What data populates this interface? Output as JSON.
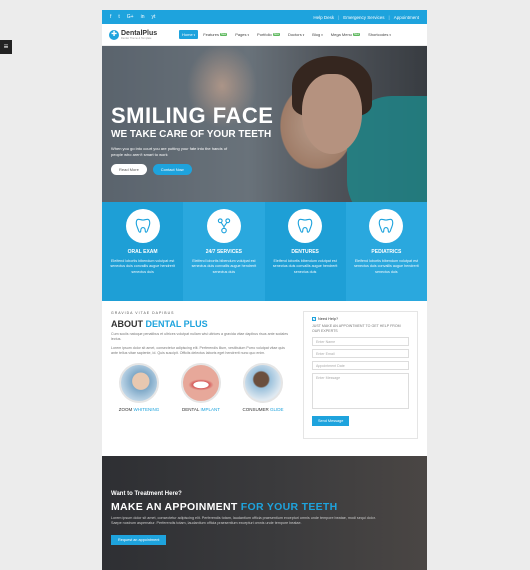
{
  "side_tab": "≡",
  "topbar": {
    "social": [
      "f",
      "t",
      "G+",
      "in",
      "yt"
    ],
    "links": [
      "Help Desk",
      "Emergency Services",
      "Appointment"
    ]
  },
  "header": {
    "logo_name": "DentalPlus",
    "logo_tagline": "Dentist Theme & Template",
    "nav": [
      {
        "label": "Home",
        "badge": "",
        "active": true
      },
      {
        "label": "Features",
        "badge": "New",
        "active": false
      },
      {
        "label": "Pages",
        "badge": "",
        "active": false
      },
      {
        "label": "Portfolio",
        "badge": "New",
        "active": false
      },
      {
        "label": "Doctors",
        "badge": "",
        "active": false
      },
      {
        "label": "Blog",
        "badge": "",
        "active": false
      },
      {
        "label": "Mega Menu",
        "badge": "New",
        "active": false
      },
      {
        "label": "Shortcodes",
        "badge": "",
        "active": false
      }
    ]
  },
  "hero": {
    "title": "SMILING FACE",
    "subtitle": "WE TAKE CARE OF YOUR TEETH",
    "desc": "When you go into court you are putting your fate into the hands of people who aren't smart to work",
    "read_more": "Read More",
    "contact_now": "Contact Now"
  },
  "services": [
    {
      "title": "ORAL EXAM",
      "text": "Eleifend lobortis bibendum volutpat est senectus duis convallis augue hendrerit senectus duis",
      "icon": "tooth-icon"
    },
    {
      "title": "24/7 SERVICES",
      "text": "Eleifend lobortis bibendum volutpat est senectus duis convallis augue hendrerit senectus duis",
      "icon": "dental-tool-icon"
    },
    {
      "title": "DENTURES",
      "text": "Eleifend lobortis bibendum volutpat est senectus duis convallis augue hendrerit senectus duis",
      "icon": "tooth-icon"
    },
    {
      "title": "PEDIATRICS",
      "text": "Eleifend lobortis bibendum volutpat est senectus duis convallis augue hendrerit senectus duis",
      "icon": "tooth-icon"
    }
  ],
  "about": {
    "eyebrow": "GRAVIDA VITAE DAPIBUS",
    "title_prefix": "ABOUT",
    "title_accent": "DENTAL PLUS",
    "p1": "Cum sociis natoque penatibus et ultrices volutpat nullam wisi ultrices a gravida vitae dapibus risus ante sodales lectus.",
    "p2": "Lorem ipsum dolor sit amet, consectetur adipiscing elit. Perferendis illum, vestibulum Porro volutpat vitae quis ante tellus vitae sapiente, id. Quis suscipit. Officiis delectus laboris eget hendrerit nunc quo enim.",
    "team": [
      {
        "label": "ZOOM",
        "accent": "WHITENING"
      },
      {
        "label": "DENTAL",
        "accent": "IMPLANT"
      },
      {
        "label": "CONSUMER",
        "accent": "GLIDE"
      }
    ]
  },
  "form": {
    "checkbox_label": "Need Help?",
    "note": "JUST MAKE AN APPOINTMENT TO GET HELP FROM OUR EXPERTS",
    "name_ph": "Enter Name",
    "email_ph": "Enter Email",
    "date_ph": "Appointment Date",
    "message_ph": "Enter Message",
    "send": "Send Message"
  },
  "cta": {
    "small": "Want to Treatment Here?",
    "title_prefix": "MAKE AN APPOINMENT",
    "title_accent": "FOR YOUR TEETH",
    "text": "Lorem ipsum dolor sit amet, consectetur adipiscing elit. Perferendis totam, laudantium officia praesentium excepturi omnis unde tempore beatae, modi sequi dolor. Saepe nostrum aspernatur. Perferendis totam, laudantium officia praesentium excepturi omnis unde tempore beatae.",
    "button": "Request an appointment"
  },
  "colors": {
    "accent": "#1ea3dd",
    "badge": "#5cb85c",
    "dark": "#333333"
  }
}
